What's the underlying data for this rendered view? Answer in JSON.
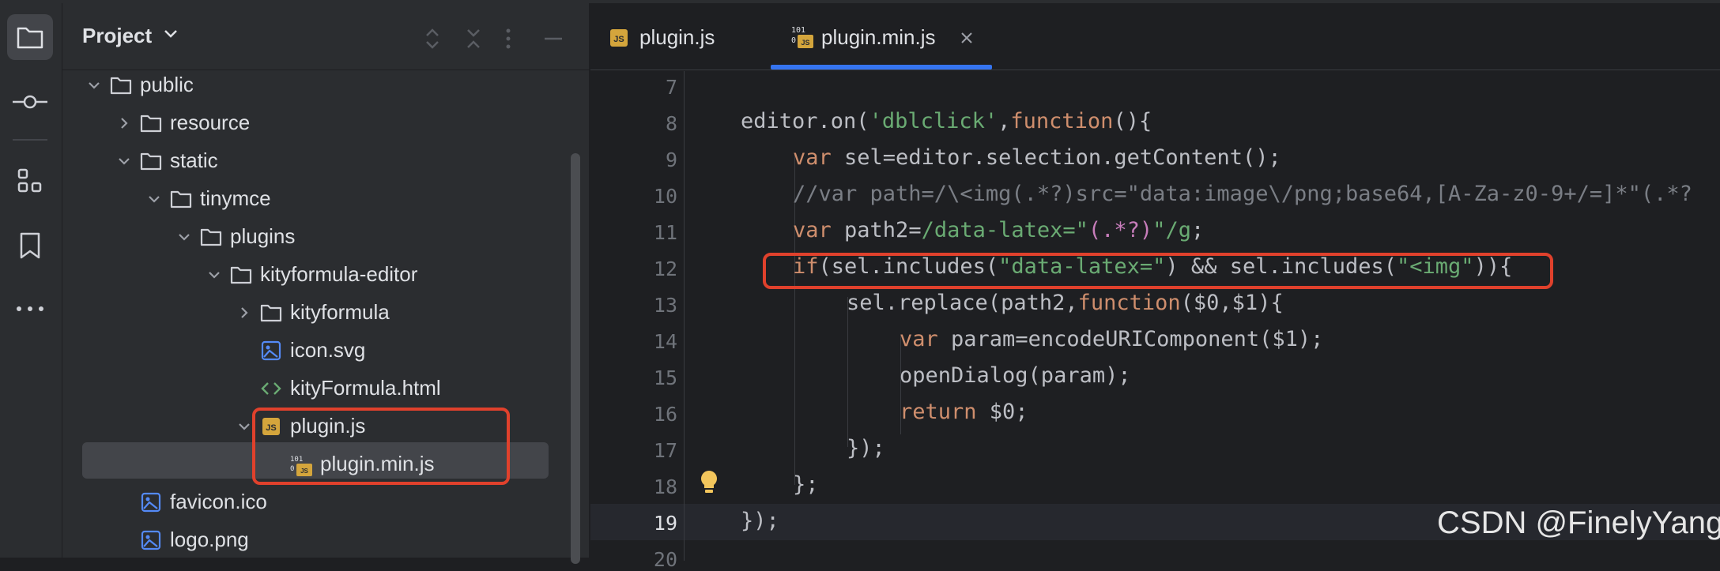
{
  "sidebar": {
    "project_title": "Project",
    "tree": [
      {
        "label": "public",
        "type": "folder",
        "expanded": true
      },
      {
        "label": "resource",
        "type": "folder",
        "expanded": false
      },
      {
        "label": "static",
        "type": "folder",
        "expanded": true
      },
      {
        "label": "tinymce",
        "type": "folder",
        "expanded": true
      },
      {
        "label": "plugins",
        "type": "folder",
        "expanded": true
      },
      {
        "label": "kityformula-editor",
        "type": "folder",
        "expanded": true
      },
      {
        "label": "kityformula",
        "type": "folder",
        "expanded": false
      },
      {
        "label": "icon.svg",
        "type": "image-file"
      },
      {
        "label": "kityFormula.html",
        "type": "html-file"
      },
      {
        "label": "plugin.js",
        "type": "js-file",
        "expanded": true
      },
      {
        "label": "plugin.min.js",
        "type": "minjs-file",
        "selected": true
      },
      {
        "label": "favicon.ico",
        "type": "image-file"
      },
      {
        "label": "logo.png",
        "type": "image-file"
      }
    ]
  },
  "tabs": [
    {
      "label": "plugin.js",
      "active": false
    },
    {
      "label": "plugin.min.js",
      "active": true
    }
  ],
  "icon_badges": {
    "js": "JS",
    "bin": "101 0"
  },
  "editor": {
    "line_numbers": [
      "7",
      "8",
      "9",
      "10",
      "11",
      "12",
      "13",
      "14",
      "15",
      "16",
      "17",
      "18",
      "19",
      "20"
    ],
    "current_line": "19"
  },
  "code": {
    "l8": {
      "a": "editor.on(",
      "b": "'dblclick'",
      "c": ",",
      "d": "function",
      "e": "(){"
    },
    "l9": {
      "a": "var",
      "b": " sel=editor.selection.getContent();"
    },
    "l10": {
      "a": "//var path=/\\<img(.*?)src=\"data:image\\/png;base64,[A-Za-z0-9+/=]*\"(.*?"
    },
    "l11": {
      "a": "var",
      "b": " path2=",
      "c": "/data-latex=\"",
      "d": "(.*?)",
      "e": "\"/g",
      "f": ";"
    },
    "l12": {
      "a": "if",
      "b": "(sel.includes(",
      "c": "\"data-latex=\"",
      "d": ") && sel.includes(",
      "e": "\"<img\"",
      "f": ")){"
    },
    "l13": {
      "a": "sel.replace(path2,",
      "b": "function",
      "c": "($0,$1){"
    },
    "l14": {
      "a": "var",
      "b": " param=encodeURIComponent($1);"
    },
    "l15": {
      "a": "openDialog(param);"
    },
    "l16": {
      "a": "return",
      "b": " $0;"
    },
    "l17": {
      "a": "});"
    },
    "l18": {
      "a": "};"
    },
    "l19": {
      "a": "});"
    }
  },
  "watermark": "CSDN @FinelyYang",
  "colors": {
    "accent": "#3574f0",
    "highlight": "#e0412c",
    "keyword": "#cf8e6d",
    "string": "#6aab73"
  }
}
